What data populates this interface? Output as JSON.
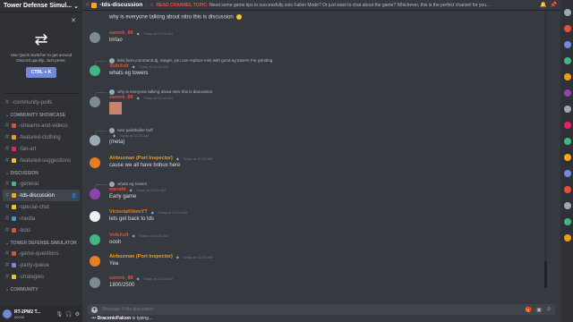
{
  "server": {
    "name": "Tower Defense Simul..."
  },
  "switcher": {
    "text": "Use Quick Switcher to get around Discord quickly. Just press:",
    "shortcut": "CTRL + K"
  },
  "sidebar": {
    "channels_top": [
      {
        "label": "-community-polls"
      }
    ],
    "categories": [
      {
        "label": "COMMUNITY SHOWCASE",
        "channels": [
          {
            "label": "-streams-and-videos",
            "emoji_color": "#e74c3c"
          },
          {
            "label": "-featured-clothing",
            "emoji_color": "#f39c12"
          },
          {
            "label": "-fan-art",
            "emoji_color": "#e91e63"
          },
          {
            "label": "-featured-suggestions",
            "emoji_color": "#f1c40f"
          }
        ]
      },
      {
        "label": "DISCUSSION",
        "channels": [
          {
            "label": "-general",
            "emoji_color": "#43b581"
          },
          {
            "label": "-tds-discussion",
            "emoji_color": "#faa61a",
            "active": true
          },
          {
            "label": "-special-chat",
            "emoji_color": "#f1c40f"
          },
          {
            "label": "-media",
            "emoji_color": "#3498db"
          },
          {
            "label": "-bots",
            "emoji_color": "#e74c3c"
          }
        ]
      },
      {
        "label": "TOWER DEFENSE SIMULATOR",
        "channels": [
          {
            "label": "-game-questions",
            "emoji_color": "#e74c3c"
          },
          {
            "label": "-party-queue",
            "emoji_color": "#7289da"
          },
          {
            "label": "-strategies",
            "emoji_color": "#f1c40f"
          }
        ]
      },
      {
        "label": "COMMUNITY",
        "channels": []
      }
    ]
  },
  "user": {
    "name": "RT-2PM2 T...",
    "tag": "#0036"
  },
  "header": {
    "channel": "-tds-discussion",
    "topic_label": "READ CHANNEL TOPIC",
    "topic": "Need some game tips to successfully solo Fallen Mode? Or just want to chat about the game? Whichever, this is the perfect channel for you..."
  },
  "messages": [
    {
      "type": "text",
      "text": "why is everyone talking about nitro this is discussion"
    },
    {
      "name": "samok_88",
      "color": "#e74c3c",
      "time": "Today at 10:23 AM",
      "text": "lmfao",
      "av": "#7f8c8d"
    },
    {
      "reply_name": "",
      "reply_text": "Mini,farm,command,dj, ranger, you can replace mini with good eg towers  For grinding",
      "name": "VolkXolt",
      "color": "#e74c3c",
      "time": "Today at 10:23 AM",
      "text": "whats eg towers",
      "av": "#43b581"
    },
    {
      "reply_name": "",
      "reply_text": "why is everyone talking about nitro this is discussion",
      "name": "samok_88",
      "color": "#e74c3c",
      "time": "Today at 10:23 AM",
      "text": "",
      "image": true,
      "av": "#7f8c8d"
    },
    {
      "reply_name": "",
      "reply_text": "new paintballer buff",
      "name": "",
      "color": "#43b581",
      "time": "Today at 10:24 AM",
      "text": "(meta)",
      "av": "#99aab5"
    },
    {
      "name": "Airbuzman (Port Inspector)",
      "color": "#f39c12",
      "time": "Today at 10:24 AM",
      "text": "cause we all have bobux here",
      "av": "#e67e22"
    },
    {
      "reply_name": "",
      "reply_text": "whats eg towers",
      "name": "wanahi",
      "color": "#e74c3c",
      "time": "Today at 10:24 AM",
      "text": "Early game",
      "av": "#8e44ad"
    },
    {
      "name": "VictoriaKittenYT",
      "color": "#e67e22",
      "time": "Today at 10:24 AM",
      "text": "lets get back to tds",
      "av": "#ecf0f1"
    },
    {
      "name": "VolkXolt",
      "color": "#e74c3c",
      "time": "Today at 10:24 AM",
      "text": "oooh",
      "av": "#43b581"
    },
    {
      "name": "Airbuzman (Port Inspector)",
      "color": "#f39c12",
      "time": "Today at 10:24 AM",
      "text": "Yea",
      "av": "#e67e22"
    },
    {
      "name": "samok_88",
      "color": "#e74c3c",
      "time": "Today at 10:24 AM",
      "text": "1800/2500",
      "av": "#7f8c8d"
    }
  ],
  "composer": {
    "placeholder": "Message #-tds-discussion"
  },
  "typing": {
    "user": "DraconicFalcon",
    "text": "is typing..."
  }
}
